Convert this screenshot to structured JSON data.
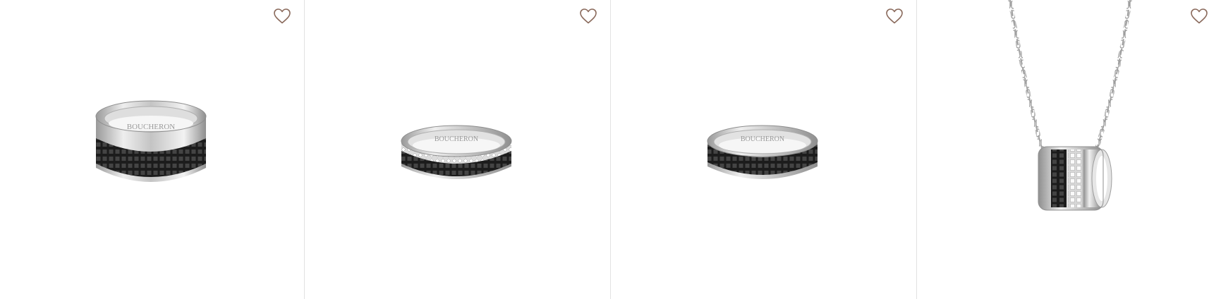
{
  "brand_engraving": "BOUCHERON",
  "colors": {
    "wishlist_icon": "#8a6a5c",
    "card_divider": "#e2e2e2"
  },
  "products": [
    {
      "image": "ring-wide-black-ceramic-icon",
      "wishlist_icon": "heart-outline-icon"
    },
    {
      "image": "ring-diamond-pave-black-ceramic-icon",
      "wishlist_icon": "heart-outline-icon"
    },
    {
      "image": "ring-thin-black-ceramic-icon",
      "wishlist_icon": "heart-outline-icon"
    },
    {
      "image": "pendant-necklace-icon",
      "wishlist_icon": "heart-outline-icon"
    }
  ]
}
